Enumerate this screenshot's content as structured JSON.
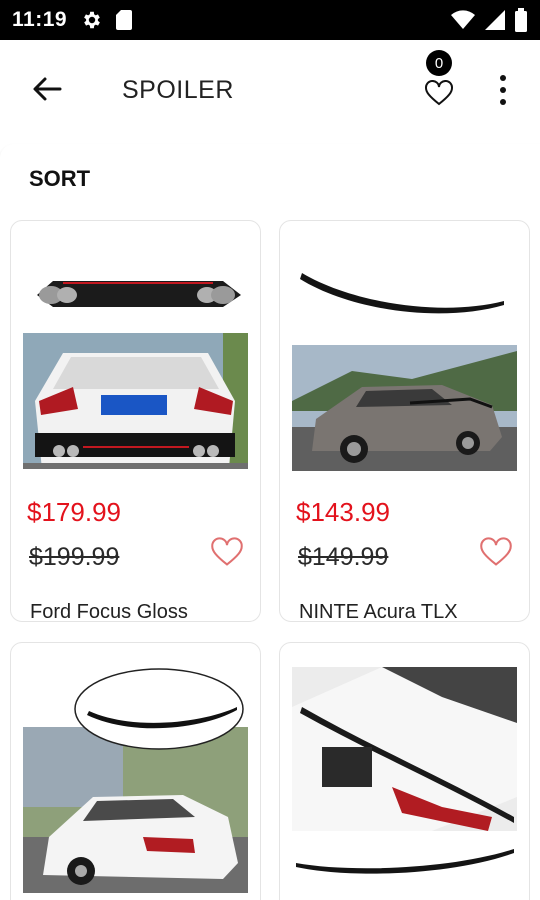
{
  "status_bar": {
    "time": "11:19",
    "icons": [
      "gear-icon",
      "sim-card-icon",
      "wifi-icon",
      "signal-icon",
      "battery-icon"
    ]
  },
  "app_bar": {
    "title": "SPOILER",
    "wishlist_count": "0",
    "icons": [
      "back-arrow-icon",
      "heart-icon",
      "more-vert-icon"
    ]
  },
  "sort": {
    "label": "SORT"
  },
  "colors": {
    "price_red": "#e3121c",
    "text": "#222222"
  },
  "products": [
    {
      "price": "$179.99",
      "old_price": "$199.99",
      "name": "Ford Focus Gloss"
    },
    {
      "price": "$143.99",
      "old_price": "$149.99",
      "name": "NINTE Acura TLX"
    },
    {
      "price": "",
      "old_price": "",
      "name": ""
    },
    {
      "price": "",
      "old_price": "",
      "name": ""
    }
  ]
}
